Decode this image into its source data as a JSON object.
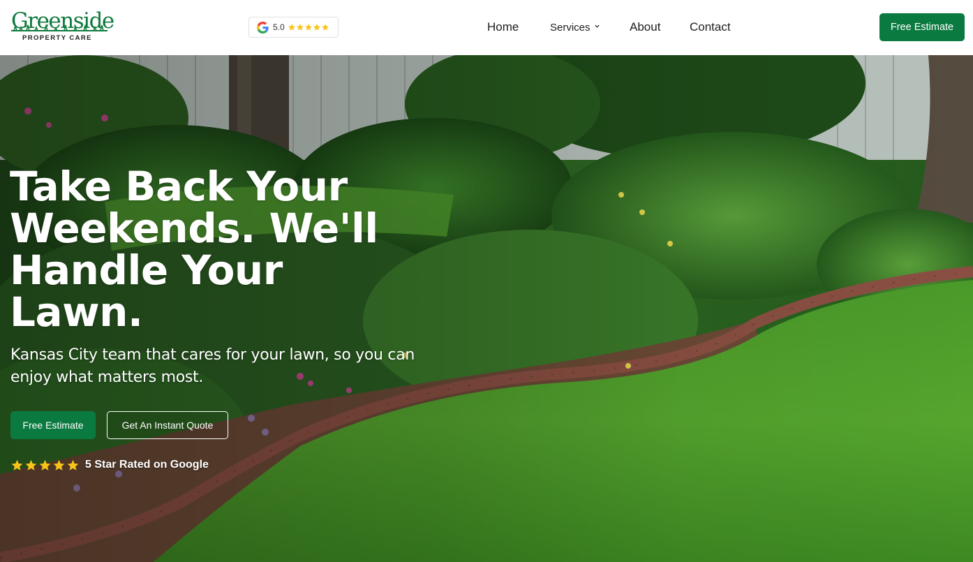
{
  "brand": {
    "name": "Greenside",
    "tagline": "PROPERTY CARE",
    "color": "#0f7a3c"
  },
  "header": {
    "google_badge": {
      "icon": "google-g-icon",
      "score": "5.0",
      "stars": 5
    },
    "nav": [
      {
        "label": "Home"
      },
      {
        "label": "Services",
        "has_dropdown": true
      },
      {
        "label": "About"
      },
      {
        "label": "Contact"
      }
    ],
    "cta_label": "Free Estimate"
  },
  "hero": {
    "title": "Take Back Your Weekends. We'll Handle Your Lawn.",
    "subtitle": "Kansas City team that cares for your lawn, so you can enjoy what matters most.",
    "primary_cta": "Free Estimate",
    "secondary_cta": "Get An Instant Quote",
    "rating_stars": 5,
    "rating_text": "5 Star Rated on Google"
  },
  "colors": {
    "primary": "#0b7a40",
    "star": "#f7c41a",
    "text_dark": "#1d1d1d"
  }
}
